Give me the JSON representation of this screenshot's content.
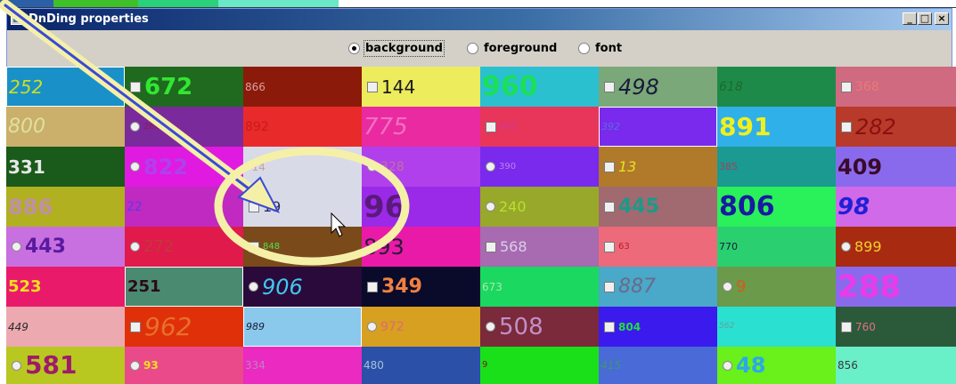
{
  "window": {
    "title": "DnDing properties"
  },
  "radio_group": {
    "options": [
      {
        "label": "background",
        "selected": true
      },
      {
        "label": "foreground",
        "selected": false
      },
      {
        "label": "font",
        "selected": false
      }
    ]
  },
  "background_strip_colors": [
    "#2b5fa8",
    "#3fbf2a",
    "#2ad07a",
    "#6ae8c8"
  ],
  "grid": {
    "columns": 8,
    "rows": 8,
    "cells": [
      {
        "text": "252",
        "bg": "#1a90c8",
        "fg": "#c8e020",
        "ctrl": "none",
        "size": 20,
        "bold": false,
        "italic": true,
        "selected": true
      },
      {
        "text": "672",
        "bg": "#1f6a1f",
        "fg": "#32e632",
        "ctrl": "checkbox",
        "size": 26,
        "bold": true,
        "italic": false
      },
      {
        "text": "866",
        "bg": "#8b1a0a",
        "fg": "#d9a0a0",
        "ctrl": "none",
        "size": 12,
        "bold": false,
        "italic": false
      },
      {
        "text": "144",
        "bg": "#ecec5c",
        "fg": "#1a1a1a",
        "ctrl": "checkbox",
        "size": 20,
        "bold": false,
        "italic": false
      },
      {
        "text": "960",
        "bg": "#2ac0d0",
        "fg": "#1ae05a",
        "ctrl": "none",
        "size": 30,
        "bold": true,
        "italic": false
      },
      {
        "text": "498",
        "bg": "#7aa878",
        "fg": "#1a1a3a",
        "ctrl": "checkbox",
        "size": 24,
        "bold": false,
        "italic": true
      },
      {
        "text": "618",
        "bg": "#1e8a4a",
        "fg": "#1a6a2a",
        "ctrl": "none",
        "size": 14,
        "bold": false,
        "italic": true
      },
      {
        "text": "368",
        "bg": "#d06a80",
        "fg": "#e87a7a",
        "ctrl": "checkbox",
        "size": 14,
        "bold": false,
        "italic": false
      },
      {
        "text": "800",
        "bg": "#cab06a",
        "fg": "#e0e0a0",
        "ctrl": "none",
        "size": 22,
        "bold": false,
        "italic": true
      },
      {
        "text": "266",
        "bg": "#7a2a9a",
        "fg": "#8a1a5a",
        "ctrl": "radio",
        "size": 10,
        "bold": false,
        "italic": false
      },
      {
        "text": "892",
        "bg": "#e82a2a",
        "fg": "#c81a1a",
        "ctrl": "none",
        "size": 14,
        "bold": false,
        "italic": false
      },
      {
        "text": "775",
        "bg": "#ea2aa0",
        "fg": "#f070c0",
        "ctrl": "none",
        "size": 26,
        "bold": false,
        "italic": true
      },
      {
        "text": "401",
        "bg": "#e8355a",
        "fg": "#c83aa0",
        "ctrl": "checkbox",
        "size": 10,
        "bold": false,
        "italic": true
      },
      {
        "text": "392",
        "bg": "#7a2aec",
        "fg": "#5a6ae0",
        "ctrl": "none",
        "size": 11,
        "bold": false,
        "italic": true,
        "selected": true
      },
      {
        "text": "891",
        "bg": "#30b0e8",
        "fg": "#f0f020",
        "ctrl": "none",
        "size": 28,
        "bold": true,
        "italic": false
      },
      {
        "text": "282",
        "bg": "#b83a2a",
        "fg": "#8a1010",
        "ctrl": "checkbox",
        "size": 24,
        "bold": false,
        "italic": true
      },
      {
        "text": "331",
        "bg": "#1a5a1a",
        "fg": "#e8e8e8",
        "ctrl": "none",
        "size": 20,
        "bold": true,
        "italic": false
      },
      {
        "text": "822",
        "bg": "#e01ae0",
        "fg": "#b040ec",
        "ctrl": "radio",
        "size": 24,
        "bold": true,
        "italic": false
      },
      {
        "text": "714",
        "bg": "#d8dae8",
        "fg": "#c8a0a0",
        "ctrl": "none",
        "size": 12,
        "bold": false,
        "italic": false
      },
      {
        "text": "328",
        "bg": "#b040ec",
        "fg": "#c070a0",
        "ctrl": "radio",
        "size": 14,
        "bold": false,
        "italic": false
      },
      {
        "text": "390",
        "bg": "#7a2aec",
        "fg": "#c080e8",
        "ctrl": "radio",
        "size": 10,
        "bold": false,
        "italic": false
      },
      {
        "text": "13",
        "bg": "#b07a2a",
        "fg": "#e8e020",
        "ctrl": "checkbox",
        "size": 16,
        "bold": false,
        "italic": true
      },
      {
        "text": "385",
        "bg": "#1a9a90",
        "fg": "#a04060",
        "ctrl": "none",
        "size": 11,
        "bold": false,
        "italic": false
      },
      {
        "text": "409",
        "bg": "#8a6aec",
        "fg": "#3a0a2a",
        "ctrl": "none",
        "size": 24,
        "bold": true,
        "italic": false
      },
      {
        "text": "886",
        "bg": "#b0b020",
        "fg": "#c090a8",
        "ctrl": "none",
        "size": 24,
        "bold": true,
        "italic": false
      },
      {
        "text": "22",
        "bg": "#c02ac0",
        "fg": "#5a3ae8",
        "ctrl": "none",
        "size": 14,
        "bold": false,
        "italic": false
      },
      {
        "text": "19",
        "bg": "#d8dae8",
        "fg": "#2a2a5a",
        "ctrl": "checkbox",
        "size": 16,
        "bold": false,
        "italic": false
      },
      {
        "text": "96",
        "bg": "#9a2ae8",
        "fg": "#5a1a7a",
        "ctrl": "none",
        "size": 34,
        "bold": true,
        "italic": false
      },
      {
        "text": "240",
        "bg": "#98a82a",
        "fg": "#b8e030",
        "ctrl": "radio",
        "size": 16,
        "bold": false,
        "italic": false
      },
      {
        "text": "445",
        "bg": "#a06a70",
        "fg": "#1a9a8a",
        "ctrl": "checkbox",
        "size": 22,
        "bold": true,
        "italic": false
      },
      {
        "text": "806",
        "bg": "#2af05a",
        "fg": "#1a1aa0",
        "ctrl": "none",
        "size": 30,
        "bold": true,
        "italic": false
      },
      {
        "text": "98",
        "bg": "#d06ae8",
        "fg": "#2020d8",
        "ctrl": "none",
        "size": 26,
        "bold": true,
        "italic": true
      },
      {
        "text": "443",
        "bg": "#c870e0",
        "fg": "#5a1aa0",
        "ctrl": "radio",
        "size": 22,
        "bold": true,
        "italic": false
      },
      {
        "text": "272",
        "bg": "#e01a4a",
        "fg": "#c03a3a",
        "ctrl": "radio",
        "size": 18,
        "bold": false,
        "italic": false
      },
      {
        "text": "848",
        "bg": "#7a4a1a",
        "fg": "#50e050",
        "ctrl": "checkbox",
        "size": 10,
        "bold": false,
        "italic": false
      },
      {
        "text": "893",
        "bg": "#ea1aa8",
        "fg": "#2a1a3a",
        "ctrl": "none",
        "size": 24,
        "bold": false,
        "italic": false
      },
      {
        "text": "568",
        "bg": "#a86ab0",
        "fg": "#d8d0e8",
        "ctrl": "checkbox",
        "size": 16,
        "bold": false,
        "italic": false
      },
      {
        "text": "63",
        "bg": "#ec6a7a",
        "fg": "#c01a2a",
        "ctrl": "checkbox",
        "size": 10,
        "bold": false,
        "italic": false
      },
      {
        "text": "770",
        "bg": "#2ad070",
        "fg": "#1a1a3a",
        "ctrl": "none",
        "size": 11,
        "bold": false,
        "italic": false
      },
      {
        "text": "899",
        "bg": "#a82a10",
        "fg": "#f0d030",
        "ctrl": "radio",
        "size": 16,
        "bold": false,
        "italic": false
      },
      {
        "text": "523",
        "bg": "#ea1a6a",
        "fg": "#f0e020",
        "ctrl": "none",
        "size": 18,
        "bold": true,
        "italic": false
      },
      {
        "text": "251",
        "bg": "#4a8a70",
        "fg": "#2a0a1a",
        "ctrl": "none",
        "size": 18,
        "bold": true,
        "italic": false,
        "selected": true
      },
      {
        "text": "906",
        "bg": "#2a0a3a",
        "fg": "#40c8f0",
        "ctrl": "radio",
        "size": 24,
        "bold": false,
        "italic": true
      },
      {
        "text": "349",
        "bg": "#0a0a2a",
        "fg": "#f08040",
        "ctrl": "checkbox",
        "size": 22,
        "bold": true,
        "italic": false
      },
      {
        "text": "673",
        "bg": "#1ad860",
        "fg": "#a8e8b0",
        "ctrl": "none",
        "size": 12,
        "bold": false,
        "italic": false
      },
      {
        "text": "887",
        "bg": "#4aa8c8",
        "fg": "#6a6a8a",
        "ctrl": "checkbox",
        "size": 22,
        "bold": false,
        "italic": true
      },
      {
        "text": "9",
        "bg": "#6a9a4a",
        "fg": "#d85a1a",
        "ctrl": "radio",
        "size": 18,
        "bold": false,
        "italic": false
      },
      {
        "text": "288",
        "bg": "#8a6aec",
        "fg": "#ea3aea",
        "ctrl": "none",
        "size": 34,
        "bold": true,
        "italic": false
      },
      {
        "text": "449",
        "bg": "#ecaab0",
        "fg": "#2a2a2a",
        "ctrl": "none",
        "size": 12,
        "bold": false,
        "italic": true
      },
      {
        "text": "962",
        "bg": "#e0300a",
        "fg": "#e8702a",
        "ctrl": "checkbox",
        "size": 28,
        "bold": false,
        "italic": true
      },
      {
        "text": "989",
        "bg": "#8ac8ec",
        "fg": "#1a1a3a",
        "ctrl": "none",
        "size": 11,
        "bold": false,
        "italic": true,
        "selected": true
      },
      {
        "text": "972",
        "bg": "#d8a020",
        "fg": "#e06a70",
        "ctrl": "radio",
        "size": 14,
        "bold": false,
        "italic": false
      },
      {
        "text": "508",
        "bg": "#7a2a3a",
        "fg": "#c090c8",
        "ctrl": "radio",
        "size": 26,
        "bold": false,
        "italic": false
      },
      {
        "text": "804",
        "bg": "#3a1aec",
        "fg": "#20e040",
        "ctrl": "checkbox",
        "size": 12,
        "bold": true,
        "italic": false
      },
      {
        "text": "562",
        "bg": "#2ae0d0",
        "fg": "#60a0a0",
        "ctrl": "none",
        "size": 9,
        "bold": false,
        "italic": true
      },
      {
        "text": "760",
        "bg": "#2a5a3a",
        "fg": "#e07080",
        "ctrl": "checkbox",
        "size": 12,
        "bold": false,
        "italic": false
      },
      {
        "text": "581",
        "bg": "#b8c820",
        "fg": "#a01a6a",
        "ctrl": "radio",
        "size": 28,
        "bold": true,
        "italic": false
      },
      {
        "text": "93",
        "bg": "#ea4a8a",
        "fg": "#f0e020",
        "ctrl": "radio",
        "size": 12,
        "bold": true,
        "italic": false
      },
      {
        "text": "334",
        "bg": "#ea2ac0",
        "fg": "#c080c0",
        "ctrl": "none",
        "size": 12,
        "bold": false,
        "italic": false
      },
      {
        "text": "480",
        "bg": "#2a50a8",
        "fg": "#a8c0d8",
        "ctrl": "none",
        "size": 12,
        "bold": false,
        "italic": false
      },
      {
        "text": "9",
        "bg": "#1ae01a",
        "fg": "#7a1a1a",
        "ctrl": "none",
        "size": 10,
        "bold": false,
        "italic": false
      },
      {
        "text": "415",
        "bg": "#4a6ad8",
        "fg": "#3a9a6a",
        "ctrl": "none",
        "size": 12,
        "bold": false,
        "italic": true
      },
      {
        "text": "48",
        "bg": "#6af01a",
        "fg": "#2aa8ec",
        "ctrl": "radio",
        "size": 24,
        "bold": true,
        "italic": false
      },
      {
        "text": "856",
        "bg": "#6af0c8",
        "fg": "#3a3a3a",
        "ctrl": "none",
        "size": 12,
        "bold": false,
        "italic": false
      }
    ]
  }
}
